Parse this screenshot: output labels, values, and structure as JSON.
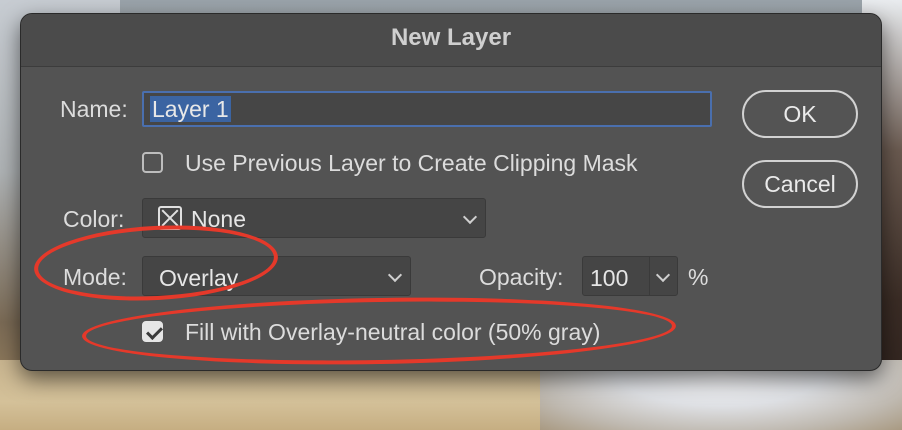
{
  "dialog": {
    "title": "New Layer",
    "name_label": "Name:",
    "name_value": "Layer 1",
    "clipping_label": "Use Previous Layer to Create Clipping Mask",
    "clipping_checked": false,
    "color_label": "Color:",
    "color_value": "None",
    "mode_label": "Mode:",
    "mode_value": "Overlay",
    "opacity_label": "Opacity:",
    "opacity_value": "100",
    "opacity_unit": "%",
    "fill_label": "Fill with Overlay-neutral color (50% gray)",
    "fill_checked": true,
    "ok_label": "OK",
    "cancel_label": "Cancel"
  },
  "icons": {
    "chevron": "chevron-down-icon",
    "color_swatch": "no-color-x-icon",
    "check": "checkmark-icon"
  },
  "colors": {
    "dialog_bg": "#535353",
    "selection": "#3b64a2",
    "focus_ring": "#4a6fae",
    "annotation": "#e5392a"
  }
}
